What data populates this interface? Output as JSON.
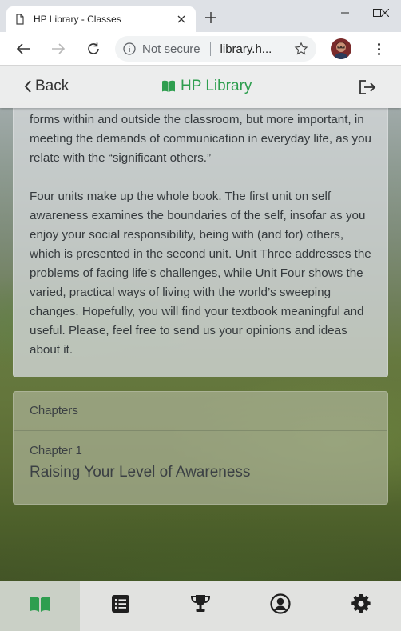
{
  "browser": {
    "tab_title": "HP Library - Classes",
    "omnibox": {
      "security_label": "Not secure",
      "url": "library.h..."
    }
  },
  "app": {
    "back_label": "Back",
    "brand_title": "HP Library",
    "accent_color": "#2e9e4f"
  },
  "intro": {
    "paragraphs": [
      "forms within and outside the classroom, but more important, in meeting the demands of communication in everyday life, as you relate with the “significant others.”",
      "Four units make up the whole book. The first unit on self awareness examines the boundaries of the self, insofar as you enjoy your social responsibility, being with (and for) others, which is presented in the second unit. Unit Three addresses the problems of facing life’s challenges, while Unit Four shows the varied, practical ways of living with the world’s sweeping changes. Hopefully, you will find your textbook meaningful and useful. Please, feel free to send us your opinions and ideas about it."
    ]
  },
  "chapters": {
    "header": "Chapters",
    "items": [
      {
        "number_label": "Chapter 1",
        "title": "Raising Your Level of Awareness"
      }
    ]
  },
  "bottom_nav": [
    {
      "icon": "book-open-icon",
      "active": true
    },
    {
      "icon": "list-icon",
      "active": false
    },
    {
      "icon": "trophy-icon",
      "active": false
    },
    {
      "icon": "user-circle-icon",
      "active": false
    },
    {
      "icon": "gear-icon",
      "active": false
    }
  ]
}
